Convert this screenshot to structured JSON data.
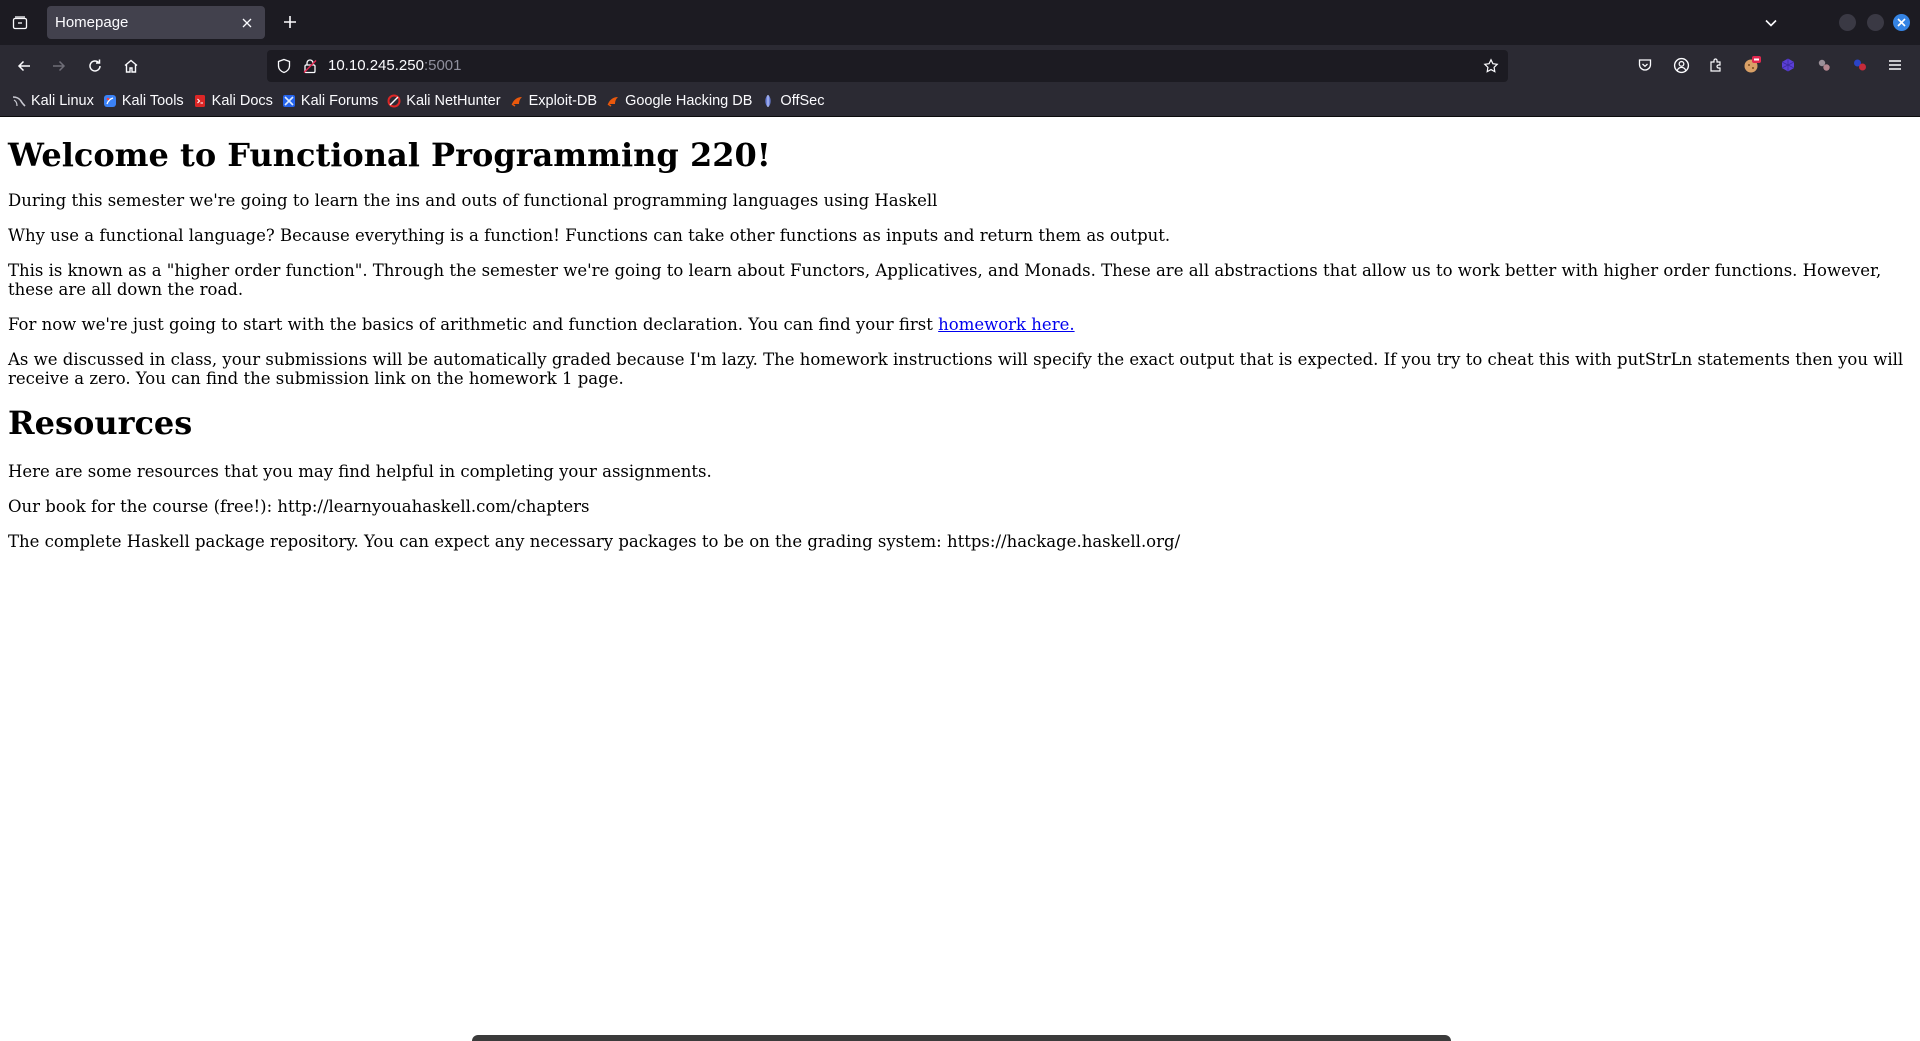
{
  "browser": {
    "tab": {
      "title": "Homepage"
    },
    "url": {
      "host": "10.10.245.250",
      "port": ":5001"
    },
    "bookmarks": [
      {
        "label": "Kali Linux",
        "icon": "kali-linux-icon",
        "color": "#9ca3af"
      },
      {
        "label": "Kali Tools",
        "icon": "kali-tools-icon",
        "color": "#3b82f6"
      },
      {
        "label": "Kali Docs",
        "icon": "kali-docs-icon",
        "color": "#dc2626"
      },
      {
        "label": "Kali Forums",
        "icon": "kali-forums-icon",
        "color": "#60a5fa"
      },
      {
        "label": "Kali NetHunter",
        "icon": "kali-nethunter-icon",
        "color": "#dc2626"
      },
      {
        "label": "Exploit-DB",
        "icon": "exploit-db-icon",
        "color": "#ea580c"
      },
      {
        "label": "Google Hacking DB",
        "icon": "google-hacking-db-icon",
        "color": "#ea580c"
      },
      {
        "label": "OffSec",
        "icon": "offsec-icon",
        "color": "#6b7fd7"
      }
    ]
  },
  "page": {
    "heading": "Welcome to Functional Programming 220!",
    "p1": "During this semester we're going to learn the ins and outs of functional programming languages using Haskell",
    "p2": "Why use a functional language? Because everything is a function! Functions can take other functions as inputs and return them as output.",
    "p3": "This is known as a \"higher order function\". Through the semester we're going to learn about Functors, Applicatives, and Monads. These are all abstractions that allow us to work better with higher order functions. However, these are all down the road.",
    "p4_text": "For now we're just going to start with the basics of arithmetic and function declaration. You can find your first ",
    "p4_link": "homework here.",
    "p5": "As we discussed in class, your submissions will be automatically graded because I'm lazy. The homework instructions will specify the exact output that is expected. If you try to cheat this with putStrLn statements then you will receive a zero. You can find the submission link on the homework 1 page.",
    "resources_heading": "Resources",
    "r1": "Here are some resources that you may find helpful in completing your assignments.",
    "r2": "Our book for the course (free!): http://learnyouahaskell.com/chapters",
    "r3": "The complete Haskell package repository. You can expect any necessary packages to be on the grading system: https://hackage.haskell.org/"
  }
}
